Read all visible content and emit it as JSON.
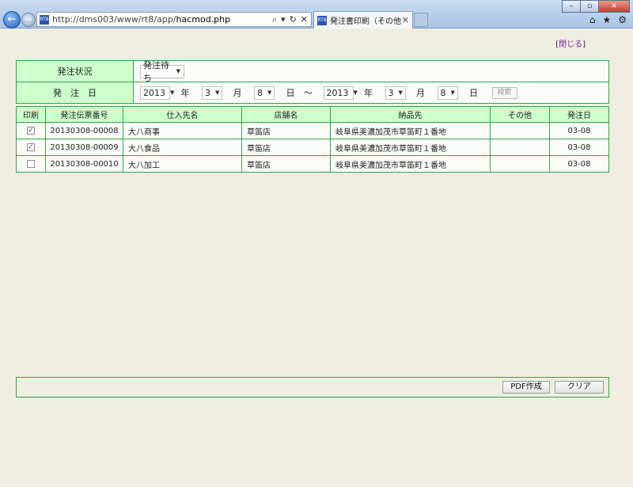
{
  "browser": {
    "url_prefix": "http://dms003/www/rt8/app/",
    "url_file": "hacmod.php",
    "tab_title": "発注書印刷（その他入力）",
    "favicon_text": "RT8",
    "win_min": "–",
    "win_max": "▫",
    "win_close": "✕",
    "back_icon": "←",
    "fwd_icon": "→",
    "addr_search_icon": "⌕",
    "addr_dropdown_icon": "▾",
    "addr_refresh_icon": "↻",
    "addr_stop_icon": "✕",
    "tab_close_icon": "✕",
    "home_icon": "⌂",
    "favorites_icon": "★",
    "tools_icon": "⚙"
  },
  "page": {
    "close_open": "[",
    "close_label": "閉じる",
    "close_close": "]"
  },
  "filter": {
    "status_label": "発注状況",
    "status_value": "発注待ち",
    "date_label": "発　注　日",
    "from_year": "2013",
    "from_month": "3",
    "from_day": "8",
    "to_year": "2013",
    "to_month": "3",
    "to_day": "8",
    "year_unit": "年",
    "month_unit": "月",
    "day_unit": "日",
    "range_sep": "～",
    "search_label": "検索",
    "dropdown_arrow": "▼"
  },
  "table": {
    "headers": {
      "print": "印刷",
      "slip_no": "発注伝票番号",
      "supplier": "仕入先名",
      "store": "店舗名",
      "delivery": "納品先",
      "other": "その他",
      "date": "発注日"
    },
    "rows": [
      {
        "checked": "✓",
        "slip_no": "20130308-00008",
        "supplier": "大八商事",
        "store": "草笛店",
        "delivery": "岐阜県美濃加茂市草笛町１番地",
        "other": "",
        "date": "03-08"
      },
      {
        "checked": "✓",
        "slip_no": "20130308-00009",
        "supplier": "大八食品",
        "store": "草笛店",
        "delivery": "岐阜県美濃加茂市草笛町１番地",
        "other": "",
        "date": "03-08"
      },
      {
        "checked": "",
        "slip_no": "20130308-00010",
        "supplier": "大八加工",
        "store": "草笛店",
        "delivery": "岐阜県美濃加茂市草笛町１番地",
        "other": "",
        "date": "03-08"
      }
    ]
  },
  "footer": {
    "pdf_label": "PDF作成",
    "clear_label": "クリア"
  }
}
